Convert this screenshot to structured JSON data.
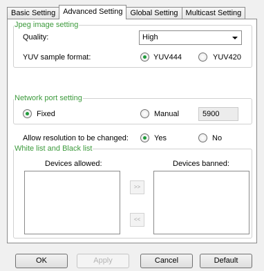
{
  "tabs": [
    {
      "label": "Basic Setting",
      "active": false
    },
    {
      "label": "Advanced Setting",
      "active": true
    },
    {
      "label": "Global Setting",
      "active": false
    },
    {
      "label": "Multicast Setting",
      "active": false
    }
  ],
  "jpeg": {
    "legend": "Jpeg image setting",
    "quality_label": "Quality:",
    "quality_value": "High",
    "yuv_label": "YUV sample format:",
    "yuv444_label": "YUV444",
    "yuv420_label": "YUV420",
    "yuv_selected": "YUV444"
  },
  "network": {
    "legend": "Network port setting",
    "fixed_label": "Fixed",
    "manual_label": "Manual",
    "port_value": "5900",
    "mode_selected": "Fixed"
  },
  "resolution": {
    "label": "Allow resolution to be changed:",
    "yes_label": "Yes",
    "no_label": "No",
    "selected": "Yes"
  },
  "lists": {
    "legend": "White list and Black list",
    "allowed_label": "Devices allowed:",
    "banned_label": "Devices banned:",
    "move_right_label": ">>",
    "move_left_label": "<<",
    "allowed_items": [],
    "banned_items": []
  },
  "buttons": {
    "ok": "OK",
    "apply": "Apply",
    "cancel": "Cancel",
    "default": "Default"
  },
  "colors": {
    "legend_text": "#3c9a3c",
    "radio_dot": "#1f9a3a"
  }
}
